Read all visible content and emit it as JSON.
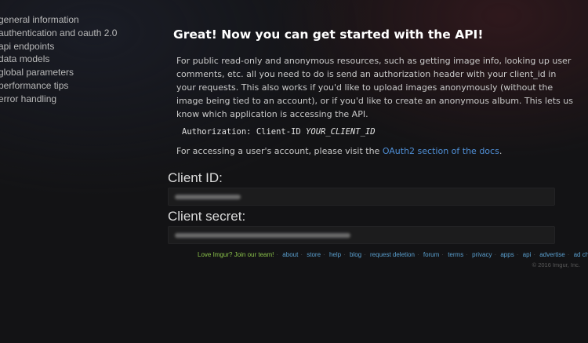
{
  "sidebar": {
    "items": [
      {
        "label": "general information"
      },
      {
        "label": "authentication and oauth 2.0"
      },
      {
        "label": "api endpoints"
      },
      {
        "label": "data models"
      },
      {
        "label": "global parameters"
      },
      {
        "label": "performance tips"
      },
      {
        "label": "error handling"
      }
    ]
  },
  "main": {
    "title": "Great! Now you can get started with the API!",
    "description": "For public read-only and anonymous resources, such as getting image info, looking up user comments, etc. all you need to do is send an authorization header with your client_id in your requests. This also works if you'd like to upload images anonymously (without the image being tied to an account), or if you'd like to create an anonymous album. This lets us know which application is accessing the API.",
    "code_prefix": "Authorization: Client-ID ",
    "code_placeholder": "YOUR_CLIENT_ID",
    "oauth_text": "For accessing a user's account, please visit the ",
    "oauth_link": "OAuth2 section of the docs",
    "oauth_suffix": "."
  },
  "client_id": {
    "label": "Client ID:"
  },
  "client_secret": {
    "label": "Client secret:"
  },
  "footer": {
    "links": [
      {
        "label": "Love Imgur? Join our team!",
        "color": "#8bc34a"
      },
      {
        "label": "about"
      },
      {
        "label": "store"
      },
      {
        "label": "help"
      },
      {
        "label": "blog"
      },
      {
        "label": "request deletion"
      },
      {
        "label": "forum"
      },
      {
        "label": "terms"
      },
      {
        "label": "privacy"
      },
      {
        "label": "apps"
      },
      {
        "label": "api"
      },
      {
        "label": "advertise"
      },
      {
        "label": "ad choices"
      }
    ],
    "copyright": "© 2016 Imgur, Inc."
  },
  "colors": {
    "link": "#4f8fd6",
    "footer_link": "#5aa0d0",
    "background": "#131315"
  }
}
